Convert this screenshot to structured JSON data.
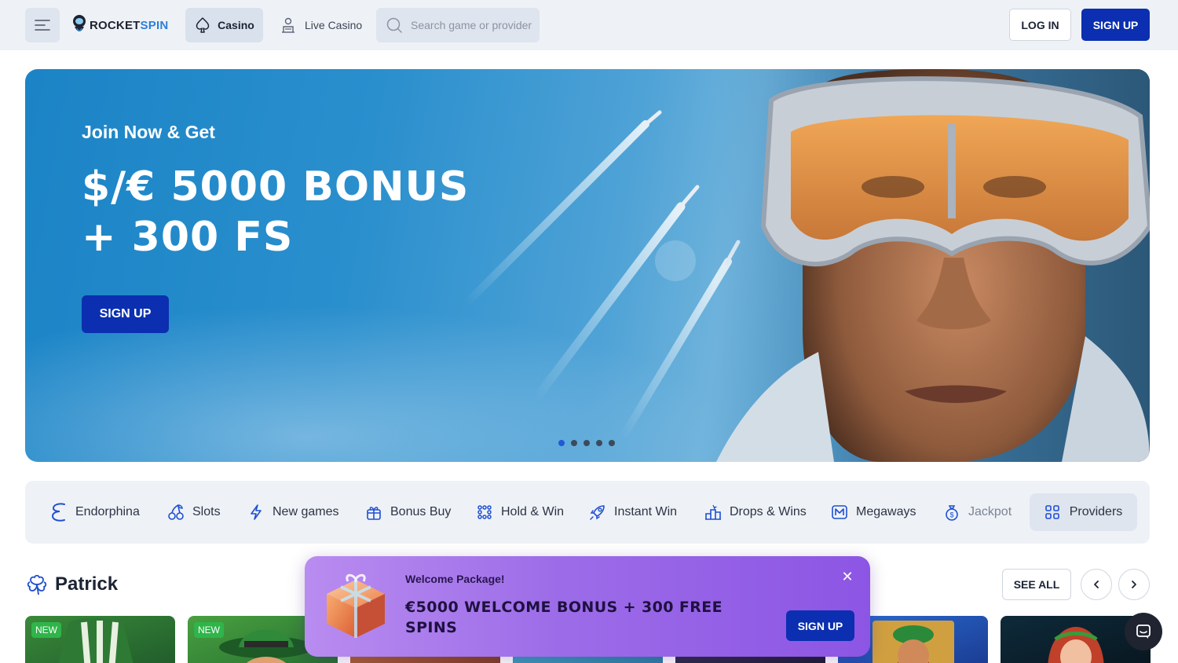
{
  "header": {
    "logo_main": "ROCKET",
    "logo_accent": "SPIN",
    "nav_casino": "Casino",
    "nav_live": "Live Casino",
    "search_placeholder": "Search game or provider",
    "login": "LOG IN",
    "signup": "SIGN UP"
  },
  "hero": {
    "subtitle": "Join Now & Get",
    "title_line1": "$/€ 5000 BONUS",
    "title_line2": "+ 300 FS",
    "button": "SIGN UP",
    "slides": 5,
    "active_slide": 1
  },
  "categories": [
    {
      "label": "Endorphina",
      "icon": "endorphina-icon"
    },
    {
      "label": "Slots",
      "icon": "cherries-icon"
    },
    {
      "label": "New games",
      "icon": "lightning-icon"
    },
    {
      "label": "Bonus Buy",
      "icon": "gift-icon"
    },
    {
      "label": "Hold & Win",
      "icon": "dots-grid-icon"
    },
    {
      "label": "Instant Win",
      "icon": "rocket-icon"
    },
    {
      "label": "Drops & Wins",
      "icon": "podium-icon"
    },
    {
      "label": "Megaways",
      "icon": "megaways-icon"
    },
    {
      "label": "Jackpot",
      "icon": "money-bag-icon"
    }
  ],
  "providers": "Providers",
  "section": {
    "title": "Patrick",
    "icon": "clover-icon",
    "see_all": "SEE ALL"
  },
  "games": [
    {
      "badge": "NEW"
    },
    {
      "badge": "NEW"
    },
    {
      "badge": ""
    },
    {
      "badge": ""
    },
    {
      "badge": ""
    },
    {
      "badge": ""
    },
    {
      "badge": ""
    }
  ],
  "popup": {
    "label": "Welcome Package!",
    "title": "€5000 WELCOME BONUS + 300 FREE SPINS",
    "button": "SIGN UP"
  },
  "colors": {
    "primary_button": "#0b2fb0",
    "header_bg": "#eef2f7",
    "new_badge": "#2fb54a",
    "popup_purple": "#9c6ce8"
  }
}
